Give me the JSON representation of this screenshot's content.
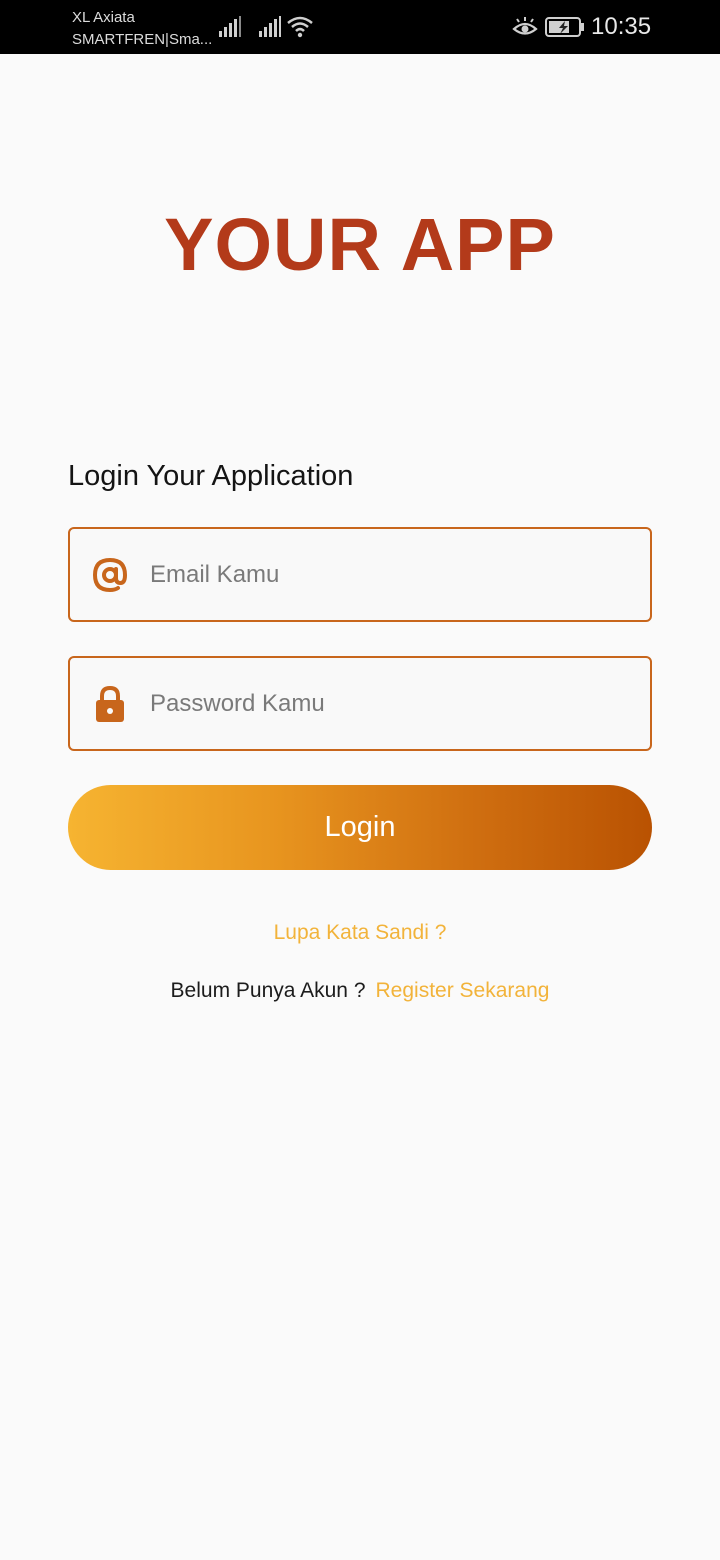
{
  "status_bar": {
    "carrier_1": "XL Axiata",
    "carrier_2": "SMARTFREN|Sma...",
    "time": "10:35",
    "icons": [
      "signal-icon",
      "signal-icon",
      "wifi-icon",
      "eye-comfort-icon",
      "battery-charging-icon"
    ]
  },
  "app": {
    "title": "YOUR APP"
  },
  "login": {
    "heading": "Login Your Application",
    "email_placeholder": "Email Kamu",
    "email_value": "",
    "password_placeholder": "Password Kamu",
    "password_value": "",
    "email_icon": "at-icon",
    "password_icon": "lock-icon",
    "button_label": "Login",
    "forgot_label": "Lupa Kata Sandi ?",
    "register_prompt": "Belum Punya Akun ?",
    "register_label": "Register Sekarang"
  },
  "colors": {
    "title": "#b33a1a",
    "field_border": "#c8661c",
    "icon": "#c8661c",
    "link": "#f2b33a",
    "button_gradient_start": "#f6b431",
    "button_gradient_end": "#b95202",
    "background": "#fafafa",
    "status_bar": "#000000"
  }
}
